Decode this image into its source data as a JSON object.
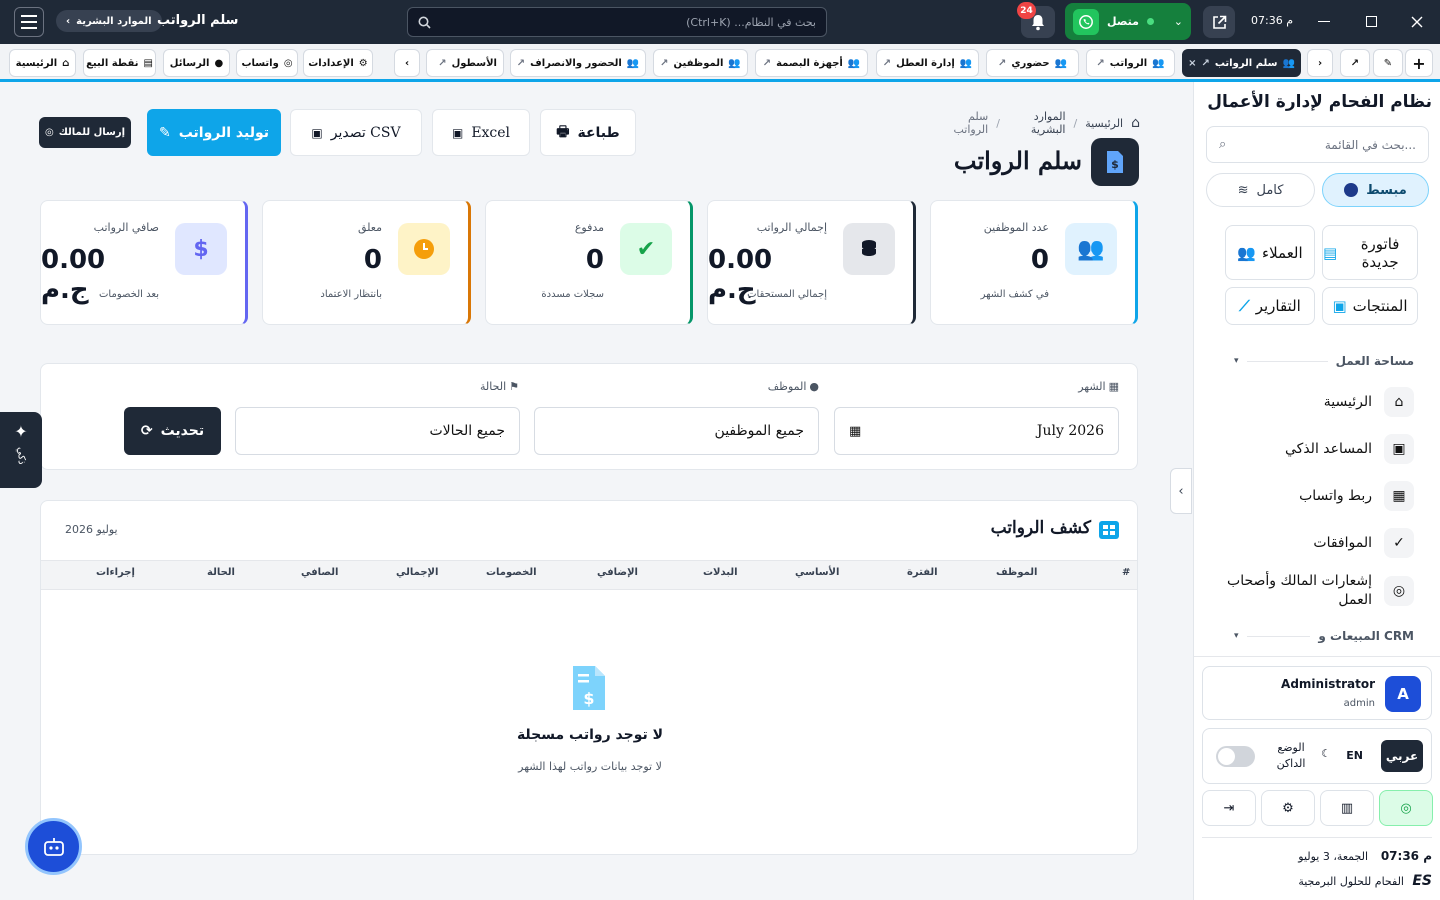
{
  "topbar": {
    "time": "07:36 م",
    "search_placeholder": "بحث في النظام... (Ctrl+K)",
    "notifications_count": "24",
    "whatsapp_status": "متصل",
    "page_title": "سلم الرواتب",
    "breadcrumb_chip": "الموارد البشرية"
  },
  "tabs": {
    "open": [
      "سلم الرواتب",
      "الرواتب",
      "حضوري",
      "إدارة العطل",
      "أجهزة البصمة",
      "الموظفين",
      "الحضور والانصراف",
      "الأسطول"
    ],
    "pinned": [
      "الإعدادات",
      "واتساب",
      "الرسائل",
      "نقطة البيع",
      "الرئيسية"
    ]
  },
  "breadcrumb": [
    "الرئيسية",
    "الموارد البشرية",
    "سلم الرواتب"
  ],
  "page": {
    "title": "سلم الرواتب",
    "actions": {
      "print": "طباعة",
      "excel": "Excel",
      "csv": "تصدير CSV",
      "generate": "توليد الرواتب",
      "send_owner": "إرسال للمالك"
    }
  },
  "stats": [
    {
      "label": "عدد الموظفين",
      "value": "0",
      "sub": "في كشف الشهر",
      "accent": "#0ea5e9"
    },
    {
      "label": "إجمالي الرواتب",
      "value": "0.00 ج.م",
      "sub": "إجمالي المستحقات",
      "accent": "#1f2937"
    },
    {
      "label": "مدفوع",
      "value": "0",
      "sub": "سجلات مسددة",
      "accent": "#059669"
    },
    {
      "label": "معلق",
      "value": "0",
      "sub": "بانتظار الاعتماد",
      "accent": "#d97706"
    },
    {
      "label": "صافي الرواتب",
      "value": "0.00 ج.م",
      "sub": "بعد الخصومات",
      "accent": "#6366f1"
    }
  ],
  "filters": {
    "month_label": "الشهر",
    "month_value": "July 2026",
    "employee_label": "الموظف",
    "employee_value": "جميع الموظفين",
    "status_label": "الحالة",
    "status_value": "جميع الحالات",
    "refresh": "تحديث"
  },
  "sheet": {
    "title": "كشف الرواتب",
    "period": "يوليو 2026",
    "columns": [
      "#",
      "الموظف",
      "الفترة",
      "الأساسي",
      "البدلات",
      "الإضافي",
      "الخصومات",
      "الإجمالي",
      "الصافي",
      "الحالة",
      "إجراءات"
    ],
    "empty_title": "لا توجد رواتب مسجلة",
    "empty_sub": "لا توجد بيانات رواتب لهذا الشهر"
  },
  "ai_tab": "ذكي",
  "sidebar": {
    "app_title": "نظام الفحام لإدارة الأعمال",
    "search_placeholder": "بحث في القائمة...",
    "mode_simple": "مبسط",
    "mode_full": "كامل",
    "quick": {
      "new_invoice": "فاتورة جديدة",
      "customers": "العملاء",
      "products": "المنتجات",
      "reports": "التقارير"
    },
    "workspace_title": "مساحة العمل",
    "nav": [
      "الرئيسية",
      "المساعد الذكي",
      "ربط واتساب",
      "الموافقات",
      "إشعارات المالك وأصحاب العمل"
    ],
    "crm_title": "المبيعات و CRM",
    "user": {
      "name": "Administrator",
      "role": "admin",
      "initial": "A"
    },
    "lang_ar": "عربي",
    "lang_en": "EN",
    "dark_mode": "الوضع الداكن",
    "clock": "07:36 م",
    "date": "الجمعة، 3 يوليو",
    "company": "الفحام للحلول البرمجية"
  },
  "colors": {
    "primary": "#0ea5e9",
    "dark": "#1f2937",
    "whatsapp": "#16a34a"
  }
}
